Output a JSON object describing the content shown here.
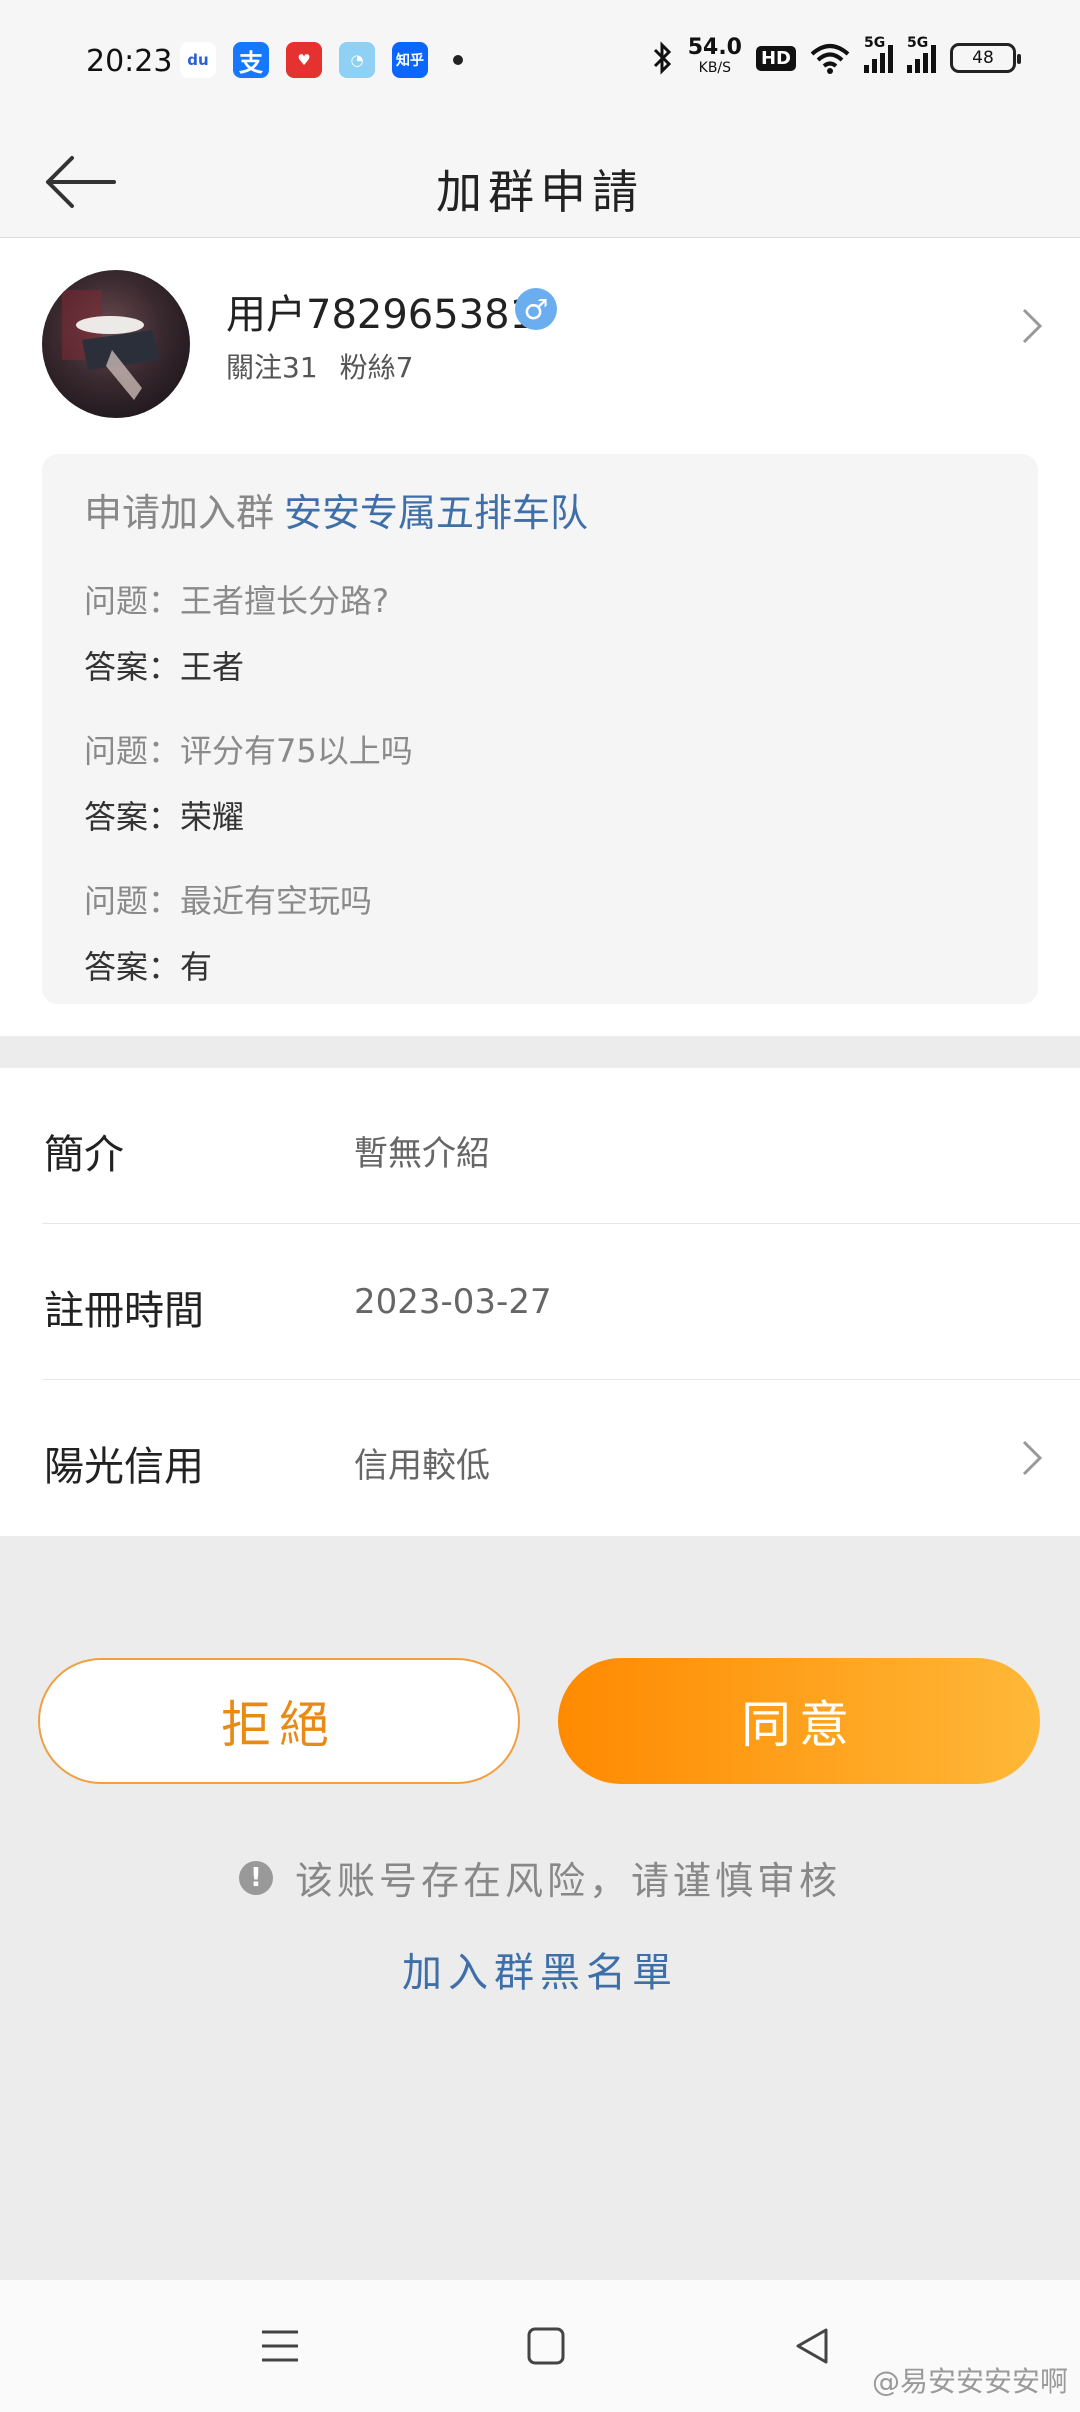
{
  "status_bar": {
    "time": "20:23",
    "apps": [
      "baidu-icon",
      "alipay-icon",
      "taobao-icon",
      "rabbit-app-icon",
      "zhihu-icon"
    ],
    "zhihu_label": "知乎",
    "alipay_label": "支",
    "baidu_label": "du",
    "net_speed": "54.0",
    "net_speed_unit": "KB/S",
    "hd_label": "HD",
    "signal1_label": "5G",
    "signal2_label": "5G",
    "battery": "48"
  },
  "header": {
    "title": "加群申請"
  },
  "user": {
    "name": "用户782965381",
    "gender_symbol": "♂",
    "following": "關注31",
    "followers": "粉絲7"
  },
  "application": {
    "prefix": "申请加入群",
    "group_name": "安安专属五排车队",
    "qa": [
      {
        "q": "问题：王者擅长分路?",
        "a": "答案：王者"
      },
      {
        "q": "问题：评分有75以上吗",
        "a": "答案：荣耀"
      },
      {
        "q": "问题：最近有空玩吗",
        "a": "答案：有"
      }
    ]
  },
  "info_rows": [
    {
      "label": "簡介",
      "value": "暫無介紹"
    },
    {
      "label": "註冊時間",
      "value": "2023-03-27"
    },
    {
      "label": "陽光信用",
      "value": "信用較低"
    }
  ],
  "actions": {
    "reject_label": "拒絕",
    "accept_label": "同意",
    "warning": "该账号存在风险，请谨慎审核",
    "warning_icon_glyph": "!",
    "blacklist_label": "加入群黑名單"
  },
  "watermark": "@易安安安安啊",
  "colors": {
    "accent_orange": "#ff8a00",
    "link_blue": "#3f6fa8",
    "gender_blue": "#6aaef0"
  }
}
